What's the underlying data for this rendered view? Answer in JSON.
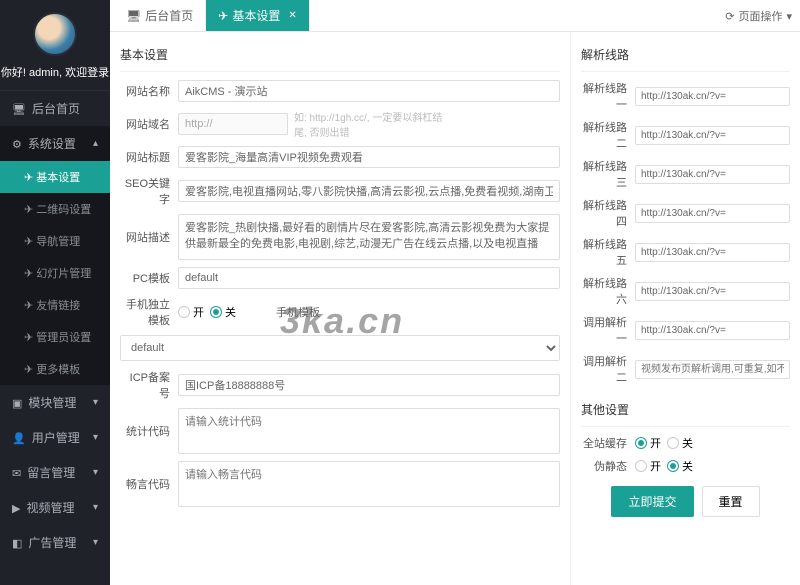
{
  "sidebar": {
    "welcome": "你好! admin, 欢迎登录",
    "home": "后台首页",
    "menus": [
      {
        "label": "系统设置",
        "expanded": true,
        "subs": [
          {
            "label": "基本设置",
            "active": true
          },
          {
            "label": "二维码设置"
          },
          {
            "label": "导航管理"
          },
          {
            "label": "幻灯片管理"
          },
          {
            "label": "友情链接"
          },
          {
            "label": "管理员设置"
          },
          {
            "label": "更多模板"
          }
        ]
      },
      {
        "label": "模块管理"
      },
      {
        "label": "用户管理"
      },
      {
        "label": "留言管理"
      },
      {
        "label": "视频管理"
      },
      {
        "label": "广告管理"
      }
    ]
  },
  "tabs": {
    "items": [
      {
        "label": "后台首页",
        "icon": "monitor"
      },
      {
        "label": "基本设置",
        "icon": "send",
        "active": true
      }
    ],
    "page_ops": "页面操作"
  },
  "form": {
    "panel1_title": "基本设置",
    "site_name_label": "网站名称",
    "site_name": "AikCMS - 演示站",
    "domain_label": "网站域名",
    "domain": "http://",
    "domain_hint": "如: http://1gh.cc/, 一定要以斜杠结尾, 否则出错",
    "title_label": "网站标题",
    "title": "爱客影院_海量高清VIP视频免费观看",
    "seo_label": "SEO关键字",
    "seo": "爱客影院,电视直播网站,零八影院快播,高清云影视,云点播,免费看视频,湖南卫视",
    "desc_label": "网站描述",
    "desc": "爱客影院_热剧快播,最好看的剧情片尽在爱客影院,高清云影视免费为大家提供最新最全的免费电影,电视剧,综艺,动漫无广告在线云点播,以及电视直播",
    "pc_tpl_label": "PC模板",
    "pc_tpl": "default",
    "mobile_alone_label": "手机独立模板",
    "mobile_tpl_label": "手机模板",
    "mobile_tpl": "default",
    "icp_label": "ICP备案号",
    "icp": "国ICP备18888888号",
    "stat_label": "统计代码",
    "stat_placeholder": "请输入统计代码",
    "chang_label": "畅言代码",
    "chang_placeholder": "请输入畅言代码",
    "on": "开",
    "off": "关"
  },
  "routes": {
    "title": "解析线路",
    "items": [
      {
        "label": "解析线路一",
        "value": "http://130ak.cn/?v="
      },
      {
        "label": "解析线路二",
        "value": "http://130ak.cn/?v="
      },
      {
        "label": "解析线路三",
        "value": "http://130ak.cn/?v="
      },
      {
        "label": "解析线路四",
        "value": "http://130ak.cn/?v="
      },
      {
        "label": "解析线路五",
        "value": "http://130ak.cn/?v="
      },
      {
        "label": "解析线路六",
        "value": "http://130ak.cn/?v="
      }
    ],
    "call1_label": "调用解析一",
    "call1_value": "http://130ak.cn/?v=",
    "call2_label": "调用解析二",
    "call2_placeholder": "视频发布页解析调用,可重复,如不用可留空"
  },
  "other": {
    "title": "其他设置",
    "cache_label": "全站缓存",
    "static_label": "伪静态"
  },
  "buttons": {
    "submit": "立即提交",
    "reset": "重置"
  },
  "watermark": "3ka.cn"
}
